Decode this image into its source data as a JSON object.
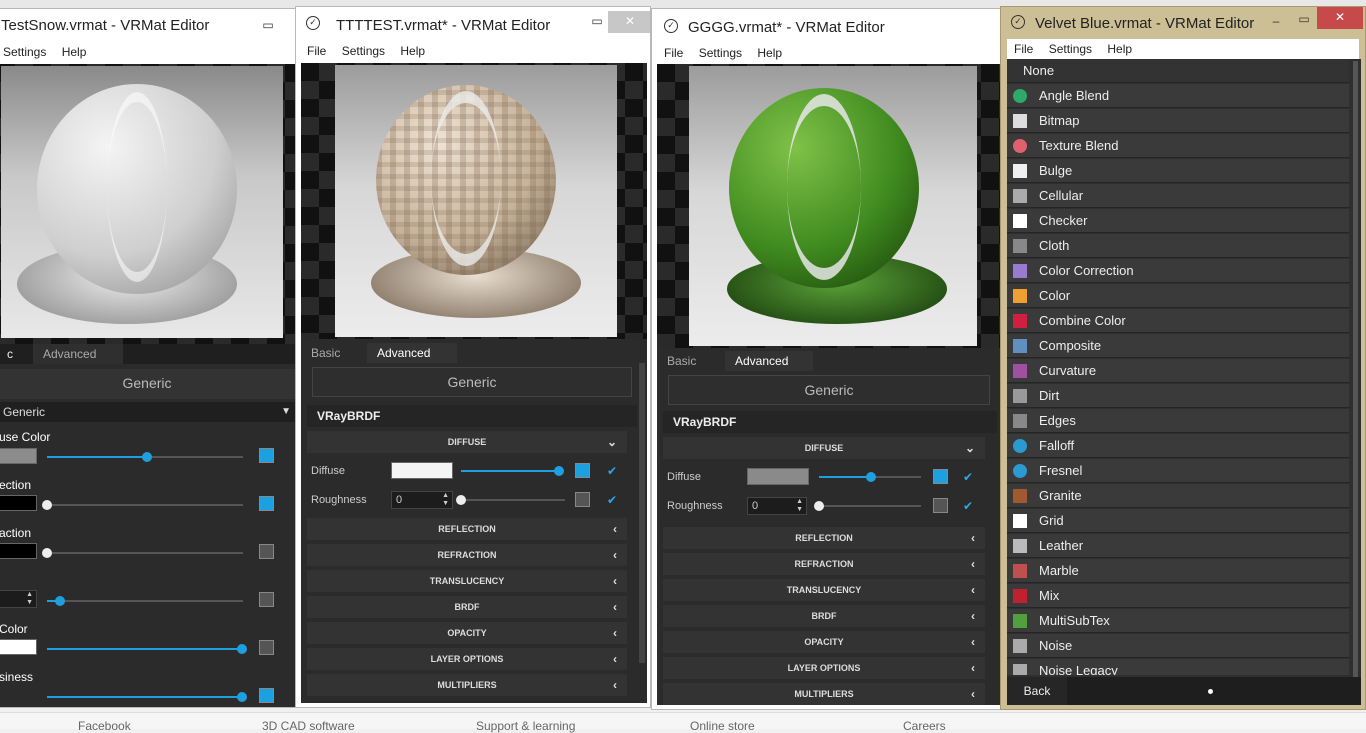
{
  "windows": {
    "w1": {
      "title": "TestSnow.vrmat - VRMat Editor",
      "menu": [
        "Settings",
        "Help"
      ],
      "tabs": [
        "c",
        "Advanced"
      ],
      "generic": "Generic",
      "dropdown": "Generic",
      "props": [
        "use Color",
        "ection",
        "action",
        "Color",
        "siness"
      ]
    },
    "w2": {
      "title": "TTTTEST.vrmat* - VRMat Editor",
      "menu": [
        "File",
        "Settings",
        "Help"
      ],
      "tabs": [
        "Basic",
        "Advanced"
      ],
      "generic": "Generic",
      "brdf": "VRayBRDF",
      "diffuse_section": "DIFFUSE",
      "diffuse_label": "Diffuse",
      "roughness_label": "Roughness",
      "roughness_value": "0",
      "sections": [
        "REFLECTION",
        "REFRACTION",
        "TRANSLUCENCY",
        "BRDF",
        "OPACITY",
        "LAYER OPTIONS",
        "MULTIPLIERS"
      ]
    },
    "w3": {
      "title": "GGGG.vrmat* - VRMat Editor",
      "menu": [
        "File",
        "Settings",
        "Help"
      ],
      "tabs": [
        "Basic",
        "Advanced"
      ],
      "generic": "Generic",
      "brdf": "VRayBRDF",
      "diffuse_section": "DIFFUSE",
      "diffuse_label": "Diffuse",
      "roughness_label": "Roughness",
      "roughness_value": "0",
      "sections": [
        "REFLECTION",
        "REFRACTION",
        "TRANSLUCENCY",
        "BRDF",
        "OPACITY",
        "LAYER OPTIONS",
        "MULTIPLIERS"
      ]
    },
    "w4": {
      "title": "Velvet Blue.vrmat - VRMat Editor",
      "menu": [
        "File",
        "Settings",
        "Help"
      ],
      "back": "Back",
      "textures": [
        {
          "label": "None",
          "icon": "none-icon",
          "color": ""
        },
        {
          "label": "Angle Blend",
          "icon": "angle-blend-icon",
          "color": "#2fa86a"
        },
        {
          "label": "Bitmap",
          "icon": "bitmap-icon",
          "color": "#dddddd"
        },
        {
          "label": "Texture Blend",
          "icon": "texture-blend-icon",
          "color": "#e06070"
        },
        {
          "label": "Bulge",
          "icon": "bulge-icon",
          "color": "#f0f0f0"
        },
        {
          "label": "Cellular",
          "icon": "cellular-icon",
          "color": "#aaaaaa"
        },
        {
          "label": "Checker",
          "icon": "checker-icon",
          "color": "#ffffff"
        },
        {
          "label": "Cloth",
          "icon": "cloth-icon",
          "color": "#888888"
        },
        {
          "label": "Color Correction",
          "icon": "color-correction-icon",
          "color": "#9a7ad0"
        },
        {
          "label": "Color",
          "icon": "color-icon",
          "color": "#f0a030"
        },
        {
          "label": "Combine Color",
          "icon": "combine-color-icon",
          "color": "#d02040"
        },
        {
          "label": "Composite",
          "icon": "composite-icon",
          "color": "#6090c0"
        },
        {
          "label": "Curvature",
          "icon": "curvature-icon",
          "color": "#a050a0"
        },
        {
          "label": "Dirt",
          "icon": "dirt-icon",
          "color": "#999999"
        },
        {
          "label": "Edges",
          "icon": "edges-icon",
          "color": "#888888"
        },
        {
          "label": "Falloff",
          "icon": "falloff-icon",
          "color": "#2a9ad0"
        },
        {
          "label": "Fresnel",
          "icon": "fresnel-icon",
          "color": "#2a9ad0"
        },
        {
          "label": "Granite",
          "icon": "granite-icon",
          "color": "#a05a30"
        },
        {
          "label": "Grid",
          "icon": "grid-icon",
          "color": "#ffffff"
        },
        {
          "label": "Leather",
          "icon": "leather-icon",
          "color": "#bbbbbb"
        },
        {
          "label": "Marble",
          "icon": "marble-icon",
          "color": "#c05050"
        },
        {
          "label": "Mix",
          "icon": "mix-icon",
          "color": "#c02030"
        },
        {
          "label": "MultiSubTex",
          "icon": "multisubtex-icon",
          "color": "#50a040"
        },
        {
          "label": "Noise",
          "icon": "noise-icon",
          "color": "#aaaaaa"
        },
        {
          "label": "Noise Legacy",
          "icon": "noise-legacy-icon",
          "color": "#aaaaaa"
        }
      ]
    }
  },
  "taskbar": {
    "items": [
      "Facebook",
      "3D CAD software",
      "Support & learning",
      "Online store",
      "Careers"
    ]
  },
  "colors": {
    "accent": "#1ea0e0",
    "panel": "#2b2b2b"
  }
}
